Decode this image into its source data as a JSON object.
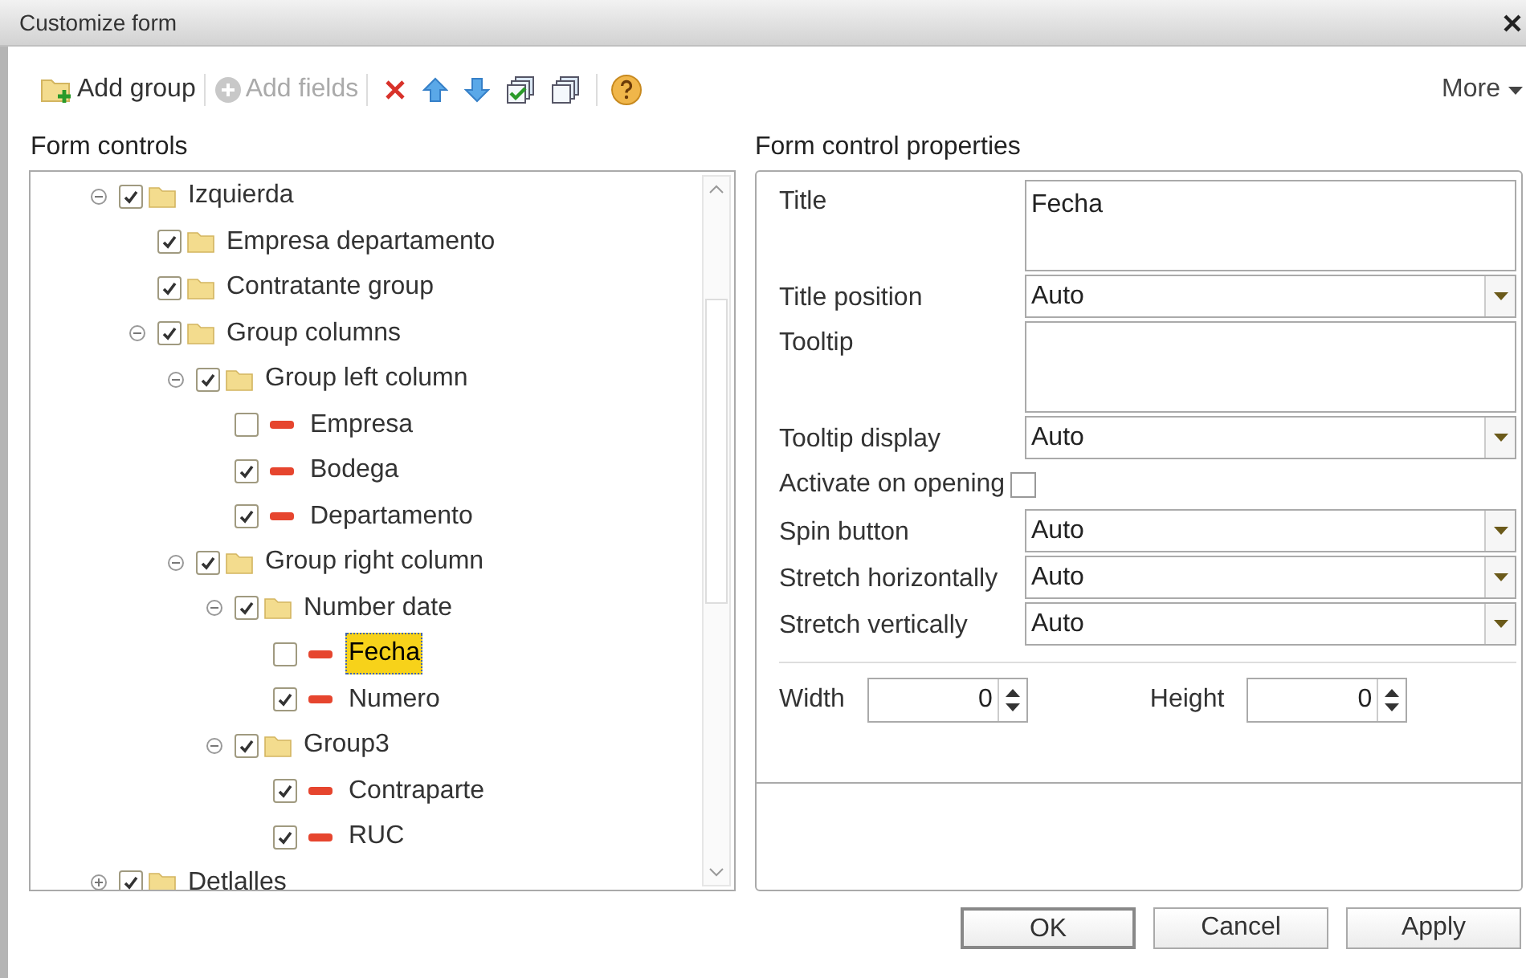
{
  "window": {
    "title": "Customize form"
  },
  "toolbar": {
    "items": [
      {
        "kind": "add-group",
        "label": "Add group",
        "disabled": false
      },
      {
        "kind": "separator"
      },
      {
        "kind": "add-fields",
        "label": "Add fields",
        "disabled": true
      },
      {
        "kind": "separator"
      },
      {
        "kind": "delete"
      },
      {
        "kind": "up"
      },
      {
        "kind": "down"
      },
      {
        "kind": "check-all"
      },
      {
        "kind": "uncheck-all"
      },
      {
        "kind": "separator"
      },
      {
        "kind": "help"
      }
    ],
    "more": "More"
  },
  "form_controls": {
    "heading": "Form controls",
    "tree": [
      {
        "label": "Izquierda",
        "kind": "folder",
        "checked": true,
        "selected": false,
        "expanded": true,
        "children": [
          {
            "label": "Empresa departamento",
            "kind": "folder",
            "checked": true,
            "selected": false
          },
          {
            "label": "Contratante group",
            "kind": "folder",
            "checked": true,
            "selected": false
          },
          {
            "label": "Group columns",
            "kind": "folder",
            "checked": true,
            "selected": false,
            "expanded": true,
            "children": [
              {
                "label": "Group left column",
                "kind": "folder",
                "checked": true,
                "selected": false,
                "expanded": true,
                "children": [
                  {
                    "label": "Empresa",
                    "kind": "field",
                    "checked": false,
                    "selected": false
                  },
                  {
                    "label": "Bodega",
                    "kind": "field",
                    "checked": true,
                    "selected": false
                  },
                  {
                    "label": "Departamento",
                    "kind": "field",
                    "checked": true,
                    "selected": false
                  }
                ]
              },
              {
                "label": "Group right column",
                "kind": "folder",
                "checked": true,
                "selected": false,
                "expanded": true,
                "children": [
                  {
                    "label": "Number date",
                    "kind": "folder",
                    "checked": true,
                    "selected": false,
                    "expanded": true,
                    "children": [
                      {
                        "label": "Fecha",
                        "kind": "field",
                        "checked": false,
                        "selected": true
                      },
                      {
                        "label": "Numero",
                        "kind": "field",
                        "checked": true,
                        "selected": false
                      }
                    ]
                  },
                  {
                    "label": "Group3",
                    "kind": "folder",
                    "checked": true,
                    "selected": false,
                    "expanded": true,
                    "children": [
                      {
                        "label": "Contraparte",
                        "kind": "field",
                        "checked": true,
                        "selected": false
                      },
                      {
                        "label": "RUC",
                        "kind": "field",
                        "checked": true,
                        "selected": false
                      }
                    ]
                  }
                ]
              }
            ]
          }
        ]
      },
      {
        "label": "Detlalles",
        "kind": "folder",
        "checked": true,
        "selected": false,
        "expanded": false
      }
    ]
  },
  "properties": {
    "heading": "Form control properties",
    "rows": [
      {
        "kind": "textarea",
        "label": "Title",
        "value": "Fecha"
      },
      {
        "kind": "select",
        "label": "Title position",
        "value": "Auto"
      },
      {
        "kind": "textarea",
        "label": "Tooltip"
      },
      {
        "kind": "select",
        "label": "Tooltip display",
        "value": "Auto"
      },
      {
        "kind": "checkbox",
        "label": "Activate on opening",
        "checked": false
      },
      {
        "kind": "select",
        "label": "Spin button",
        "value": "Auto"
      },
      {
        "kind": "select",
        "label": "Stretch horizontally",
        "value": "Auto"
      },
      {
        "kind": "select",
        "label": "Stretch vertically",
        "value": "Auto"
      }
    ],
    "size": [
      {
        "label": "Width",
        "value": "0"
      },
      {
        "label": "Height",
        "value": "0"
      }
    ]
  },
  "buttons": [
    {
      "label": "OK",
      "default": true
    },
    {
      "label": "Cancel",
      "default": false
    },
    {
      "label": "Apply",
      "default": false
    }
  ]
}
